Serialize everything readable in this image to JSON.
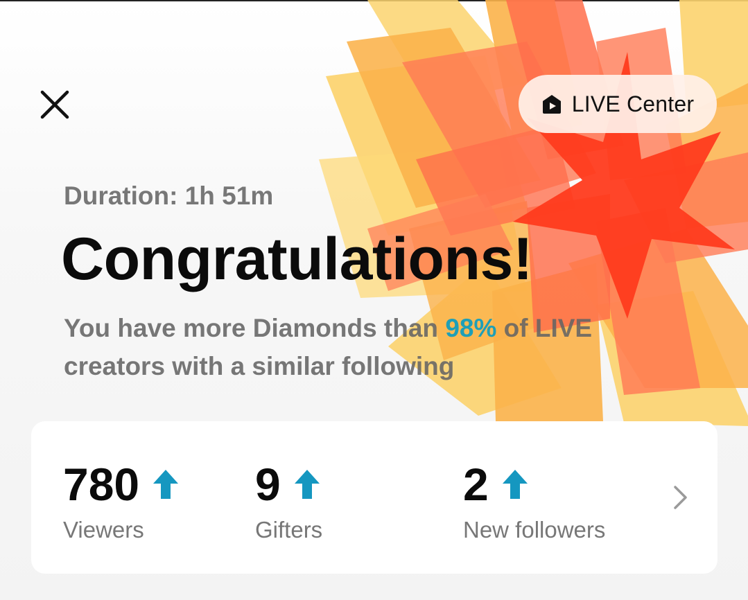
{
  "header": {
    "close_icon": "close-icon",
    "live_center": {
      "label": "LIVE Center",
      "icon": "live-house-icon"
    }
  },
  "summary": {
    "duration": "Duration: 1h 51m",
    "headline": "Congratulations!",
    "subtitle_before": "You have more Diamonds than ",
    "subtitle_percent": "98%",
    "subtitle_after": " of LIVE creators with a similar following"
  },
  "stats": [
    {
      "value": "780",
      "label": "Viewers",
      "trend": "up"
    },
    {
      "value": "9",
      "label": "Gifters",
      "trend": "up"
    },
    {
      "value": "2",
      "label": "New followers",
      "trend": "up"
    }
  ],
  "colors": {
    "accent_teal": "#1f9fb7",
    "arrow_blue": "#1597c0",
    "burst_yellow": "#fcd36e",
    "burst_orange": "#fbb24a",
    "burst_coral": "#ff7a55",
    "burst_red": "#ff3b1d"
  }
}
